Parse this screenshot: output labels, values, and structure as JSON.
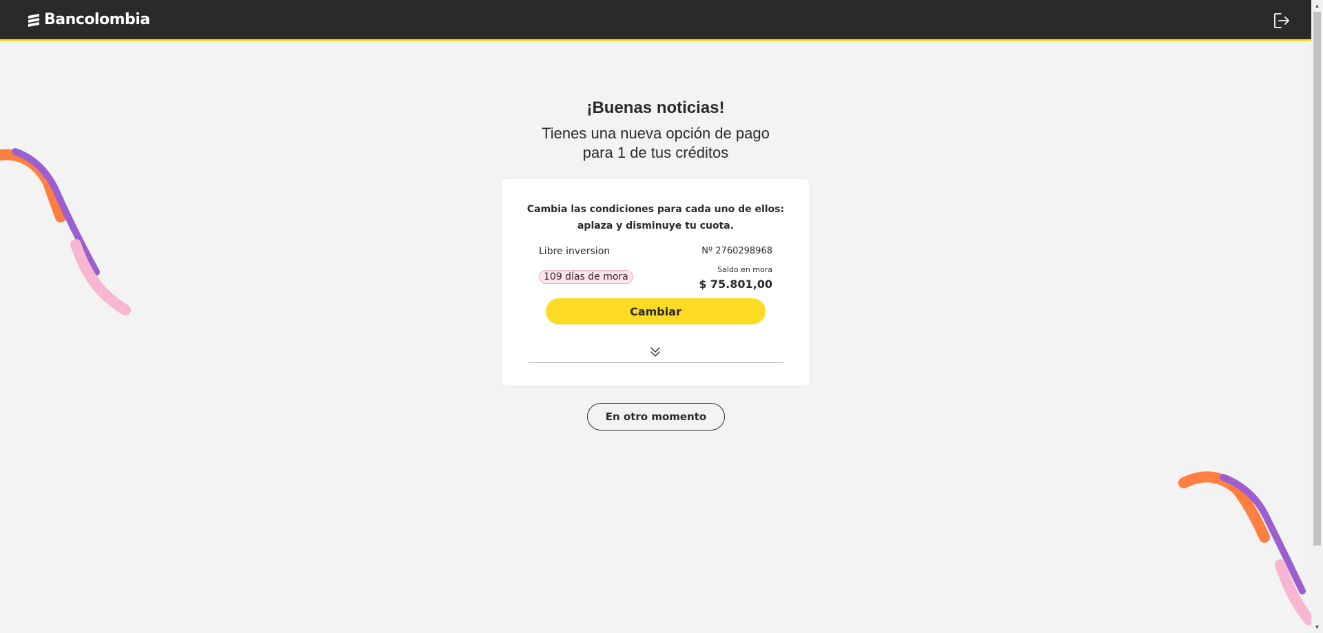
{
  "header": {
    "brand": "Bancolombia",
    "logout_icon": "logout-icon"
  },
  "main": {
    "title": "¡Buenas noticias!",
    "subtitle_line1": "Tienes una nueva opción de pago",
    "subtitle_line2": "para 1 de tus créditos"
  },
  "card": {
    "intro_line1": "Cambia las condiciones para cada uno de ellos:",
    "intro_line2": "aplaza y disminuye tu cuota.",
    "product_name": "Libre inversion",
    "product_number": "Nº 2760298968",
    "overdue_badge": "109 días de mora",
    "balance_label": "Saldo en mora",
    "balance_value": "$ 75.801,00",
    "change_button": "Cambiar",
    "expand_icon": "double-chevron-down-icon"
  },
  "actions": {
    "later_button": "En otro momento"
  },
  "colors": {
    "brand_yellow": "#fdda24",
    "header_bg": "#2c2a29",
    "page_bg": "#f3f3f3",
    "deco_orange": "#ff7f41",
    "deco_purple": "#9b5fd0",
    "deco_pink": "#f7b6d2",
    "badge_bg": "#ffe4ee"
  }
}
